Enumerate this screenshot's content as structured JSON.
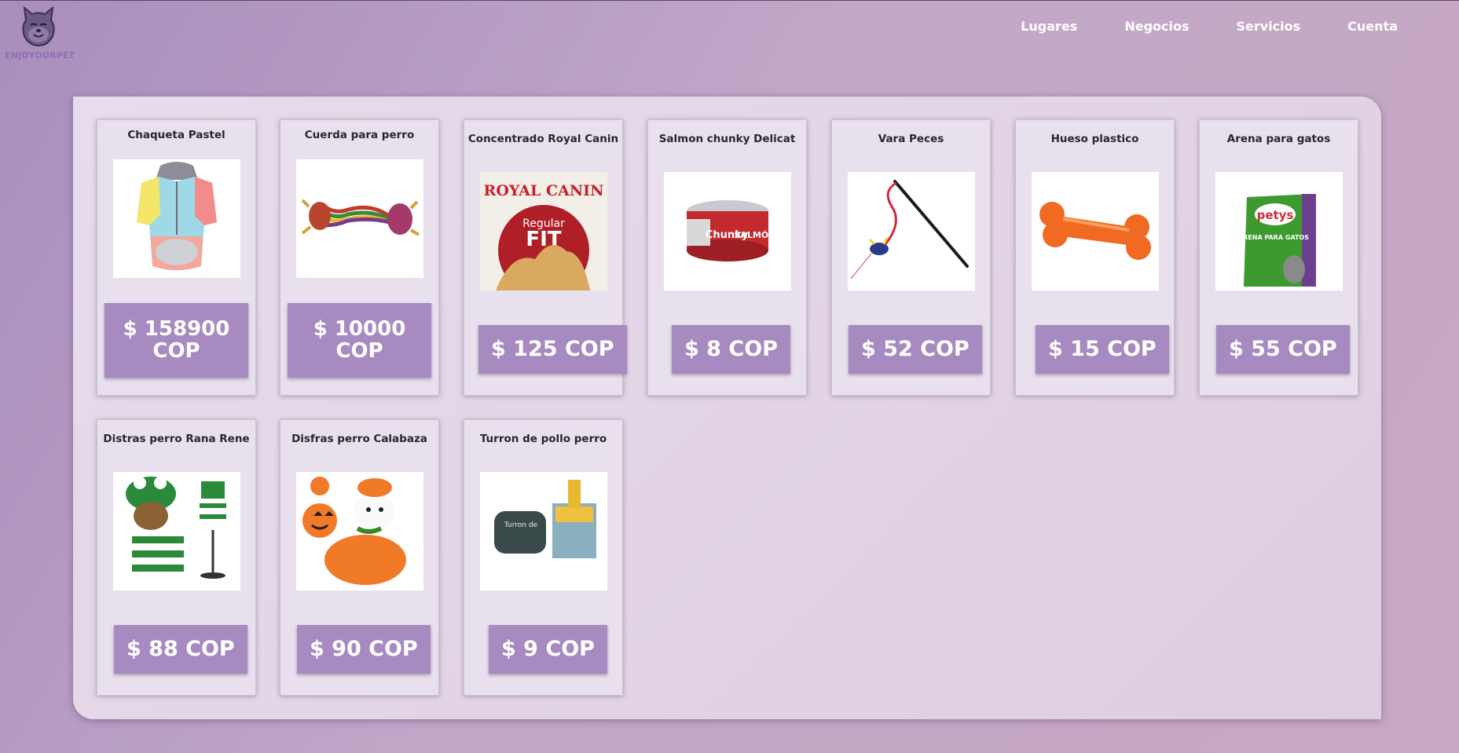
{
  "header": {
    "brand": "ENJOYOURPET",
    "nav": [
      "Lugares",
      "Negocios",
      "Servicios",
      "Cuenta"
    ]
  },
  "products": [
    {
      "title": "Chaqueta Pastel",
      "price": "$ 158900 COP",
      "image": "pastel-dog-jacket"
    },
    {
      "title": "Cuerda para perro",
      "price": "$ 10000 COP",
      "image": "rope-toy"
    },
    {
      "title": "Concentrado Royal Canin",
      "price": "$ 125 COP",
      "image": "royal-canin-bag"
    },
    {
      "title": "Salmon chunky Delicat",
      "price": "$ 8 COP",
      "image": "salmon-can"
    },
    {
      "title": "Vara Peces",
      "price": "$ 52 COP",
      "image": "fish-wand"
    },
    {
      "title": "Hueso plastico",
      "price": "$ 15 COP",
      "image": "plastic-bone"
    },
    {
      "title": "Arena para gatos",
      "price": "$ 55 COP",
      "image": "cat-litter-bag"
    },
    {
      "title": "Distras perro Rana Rene",
      "price": "$ 88 COP",
      "image": "frog-costume"
    },
    {
      "title": "Disfras perro Calabaza",
      "price": "$ 90 COP",
      "image": "pumpkin-costume"
    },
    {
      "title": "Turron de pollo perro",
      "price": "$ 9 COP",
      "image": "chicken-treat"
    }
  ],
  "image_text": {
    "royal_canin_brand": "ROYAL CANIN",
    "royal_canin_line": "Regular",
    "royal_canin_fit": "FIT",
    "salmon_brand": "Chunky",
    "salmon_label": "SALMÓN",
    "litter_brand": "petys",
    "litter_label": "ARENA PARA GATOS",
    "treat_label": "Turron de"
  },
  "colors": {
    "accent": "#a68ac0",
    "brand": "#8f6fb3",
    "card": "#e8e0ec"
  }
}
